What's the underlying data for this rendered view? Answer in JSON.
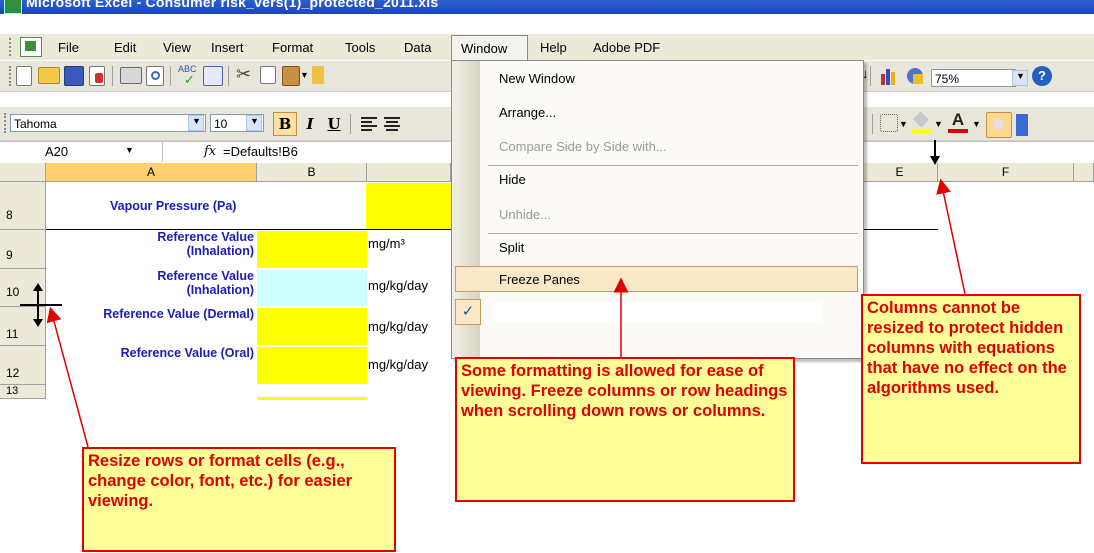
{
  "window": {
    "title": "Microsoft Excel - Consumer risk_vers(1)_protected_2011.xls"
  },
  "menu": {
    "file": "File",
    "edit": "Edit",
    "view": "View",
    "insert": "Insert",
    "format": "Format",
    "tools": "Tools",
    "data": "Data",
    "window": "Window",
    "help": "Help",
    "adobe_pdf": "Adobe PDF"
  },
  "window_menu": {
    "items": [
      "New Window",
      "Arrange...",
      "Compare Side by Side with...",
      "Hide",
      "Unhide...",
      "Split",
      "Freeze Panes"
    ],
    "disabled": [
      "Compare Side by Side with...",
      "Unhide..."
    ],
    "highlighted": "Freeze Panes"
  },
  "toolbar": {
    "zoom": "75%"
  },
  "format_toolbar": {
    "font": "Tahoma",
    "size": "10",
    "bold": "B",
    "italic": "I",
    "underline": "U"
  },
  "formula_bar": {
    "name_box": "A20",
    "fx": "fx",
    "formula": "=Defaults!B6"
  },
  "columns": [
    "A",
    "B",
    "E",
    "F"
  ],
  "rows": [
    "8",
    "9",
    "10",
    "11",
    "12",
    "13"
  ],
  "cells": {
    "a8": "Vapour Pressure (Pa)",
    "a9": "Reference Value (Inhalation)",
    "c9": "mg/m³",
    "a10": "Reference Value (Inhalation)",
    "c10": "mg/kg/day",
    "a11": "Reference Value (Dermal)",
    "c11": "mg/kg/day",
    "a12": "Reference Value (Oral)",
    "c12": "mg/kg/day"
  },
  "callouts": {
    "resize": "Resize rows or format cells (e.g., change color, font, etc.) for easier viewing.",
    "freeze": "Some formatting is allowed for ease of viewing.  Freeze columns or row headings when scrolling down rows or columns.",
    "columns": "Columns cannot be resized to protect hidden columns with equations that have no effect on the algorithms used."
  },
  "colors": {
    "highlight_yellow": "#ffff00",
    "light_blue": "#ccffff",
    "label_blue": "#1c1cb8",
    "callout_red": "#e00000",
    "callout_fill": "#ffff99"
  },
  "icons": [
    "excel-icon",
    "new-icon",
    "open-icon",
    "save-icon",
    "permission-icon",
    "print-icon",
    "print-preview-icon",
    "spelling-icon",
    "research-icon",
    "cut-icon",
    "copy-icon",
    "paste-icon",
    "chart-wizard-icon",
    "drawing-icon",
    "help-icon",
    "borders-icon",
    "fill-color-icon",
    "font-color-icon",
    "check-icon"
  ]
}
